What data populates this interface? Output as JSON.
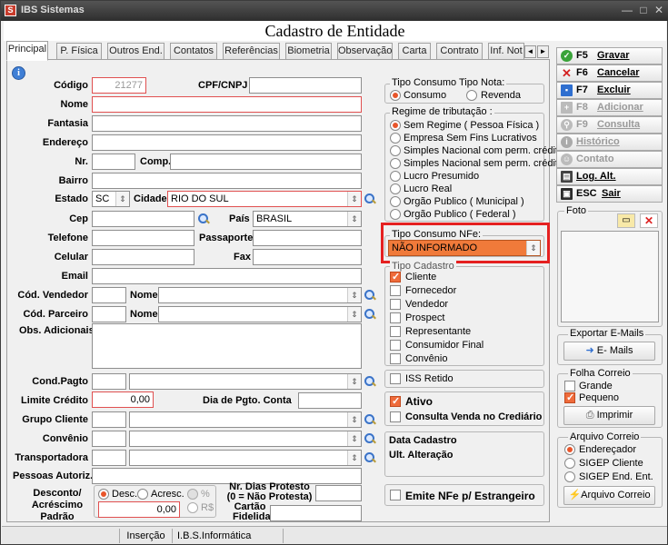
{
  "window": {
    "title": "IBS Sistemas",
    "app_icon": "S",
    "min_glyph": "—",
    "max_glyph": "□",
    "close_glyph": "✕"
  },
  "header": {
    "title": "Cadastro de Entidade"
  },
  "tabs": [
    "Principal",
    "P. Física",
    "Outros End.",
    "Contatos",
    "Referências",
    "Biometria",
    "Observação",
    "Carta",
    "Contrato",
    "Inf. Not"
  ],
  "tab_nav": {
    "prev": "◄",
    "next": "►"
  },
  "info_glyph": "i",
  "form": {
    "codigo_label": "Código",
    "codigo_value": "21277",
    "cpf_label": "CPF/CNPJ",
    "cpf_value": "",
    "nome_label": "Nome",
    "fantasia_label": "Fantasia",
    "endereco_label": "Endereço",
    "nr_label": "Nr.",
    "comp_label": "Comp.",
    "bairro_label": "Bairro",
    "estado_label": "Estado",
    "estado_value": "SC",
    "cidade_label": "Cidade",
    "cidade_value": "RIO DO SUL",
    "cep_label": "Cep",
    "pais_label": "País",
    "pais_value": "BRASIL",
    "telefone_label": "Telefone",
    "passaporte_label": "Passaporte",
    "celular_label": "Celular",
    "fax_label": "Fax",
    "email_label": "Email",
    "vendedor_label": "Cód. Vendedor",
    "parceiro_label": "Cód. Parceiro",
    "nome2_label": "Nome",
    "obs_label": "Obs. Adicionais",
    "condpagto_label": "Cond.Pagto",
    "limite_label": "Limite Crédito",
    "limite_value": "0,00",
    "diapgto_label": "Dia de Pgto. Conta",
    "grupo_label": "Grupo Cliente",
    "convenio_label": "Convênio",
    "transp_label": "Transportadora",
    "pessoas_label": "Pessoas Autoriz.",
    "desconto_label": "Desconto/ Acréscimo Padrão",
    "desc_opt": "Desc.",
    "acresc_opt": "Acresc.",
    "pct_opt": "%",
    "rs_opt": "R$",
    "desconto_value": "0,00",
    "protesto_label": "Nr. Dias Protesto (0 = Não Protesta)",
    "cartao_label": "Cartão Fidelidade"
  },
  "tipo_consumo": {
    "title": "Tipo Consumo Tipo Nota:",
    "options": [
      "Consumo",
      "Revenda"
    ],
    "selected": 0
  },
  "regime": {
    "title": "Regime de tributação :",
    "options": [
      "Sem Regime ( Pessoa Física )",
      "Empresa Sem Fins Lucrativos",
      "Simples Nacional com perm. crédito",
      "Simples Nacional sem perm. crédito",
      "Lucro Presumido",
      "Lucro Real",
      "Orgão Publico ( Municipal )",
      "Orgão Publico ( Federal )"
    ],
    "selected": 0
  },
  "nfe": {
    "title": "Tipo Consumo NFe:",
    "value": "NÃO INFORMADO",
    "highlight_color": "#e52020",
    "field_color": "#f07a3a"
  },
  "tipo_cad": {
    "title": "Tipo Cadastro",
    "options": [
      "Cliente",
      "Fornecedor",
      "Vendedor",
      "Prospect",
      "Representante",
      "Consumidor Final",
      "Convênio"
    ],
    "checked": [
      true,
      false,
      false,
      false,
      false,
      false,
      false
    ]
  },
  "checks": {
    "iss": "ISS Retido",
    "ativo": "Ativo",
    "consulta": "Consulta Venda no Crediário",
    "emite": "Emite NFe p/ Estrangeiro"
  },
  "datas": {
    "cadastro": "Data Cadastro",
    "alteracao": "Ult. Alteração"
  },
  "actions": [
    {
      "key": "F5",
      "label": "Gravar",
      "icon": "check-icon",
      "enabled": true
    },
    {
      "key": "F6",
      "label": "Cancelar",
      "icon": "cancel-icon",
      "enabled": true
    },
    {
      "key": "F7",
      "label": "Excluir",
      "icon": "delete-icon",
      "enabled": true
    },
    {
      "key": "F8",
      "label": "Adicionar",
      "icon": "add-icon",
      "enabled": false
    },
    {
      "key": "F9",
      "label": "Consulta",
      "icon": "search-icon",
      "enabled": false
    },
    {
      "key": "",
      "label": "Histórico",
      "icon": "info-icon",
      "enabled": false
    },
    {
      "key": "",
      "label": "Contato",
      "icon": "contact-icon",
      "enabled": false
    },
    {
      "key": "",
      "label": "Log. Alt.",
      "icon": "log-icon",
      "enabled": true
    },
    {
      "key": "ESC",
      "label": "Sair",
      "icon": "exit-icon",
      "enabled": true
    }
  ],
  "foto": {
    "title": "Foto"
  },
  "export": {
    "title": "Exportar E-Mails",
    "button": "E- Mails"
  },
  "folha": {
    "title": "Folha Correio",
    "options": [
      "Grande",
      "Pequeno"
    ],
    "checked": [
      false,
      true
    ],
    "button": "Imprimir"
  },
  "arquivo": {
    "title": "Arquivo Correio",
    "options": [
      "Endereçador",
      "SIGEP Cliente",
      "SIGEP End. Ent."
    ],
    "selected": 0,
    "button": "Arquivo Correio"
  },
  "status": {
    "mode": "Inserção",
    "company": "I.B.S.Informática"
  }
}
